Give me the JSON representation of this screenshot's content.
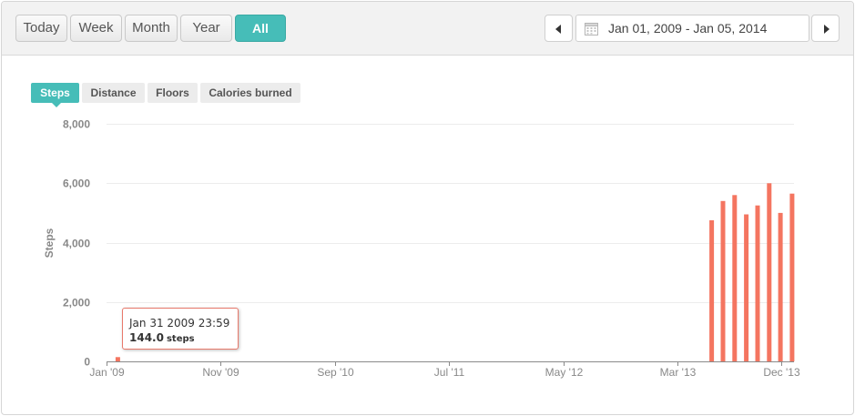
{
  "range_buttons": [
    {
      "label": "Today",
      "active": false
    },
    {
      "label": "Week",
      "active": false
    },
    {
      "label": "Month",
      "active": false
    },
    {
      "label": "Year",
      "active": false
    },
    {
      "label": "All",
      "active": true
    }
  ],
  "date_range": {
    "text": "Jan 01, 2009 - Jan 05, 2014",
    "prev_icon": "caret-left-icon",
    "next_icon": "caret-right-icon",
    "calendar_icon": "calendar-icon"
  },
  "metric_tabs": [
    {
      "label": "Steps",
      "active": true
    },
    {
      "label": "Distance",
      "active": false
    },
    {
      "label": "Floors",
      "active": false
    },
    {
      "label": "Calories burned",
      "active": false
    }
  ],
  "tooltip": {
    "time": "Jan 31 2009 23:59",
    "value": "144.0",
    "unit": "steps"
  },
  "colors": {
    "accent": "#46bdb8",
    "bar": "#f47560",
    "tooltip_border": "#e8796b"
  },
  "chart_data": {
    "type": "bar",
    "title": "",
    "xlabel": "",
    "ylabel": "Steps",
    "ylim": [
      0,
      8000
    ],
    "yticks": [
      0,
      2000,
      4000,
      6000,
      8000
    ],
    "ytick_labels": [
      "0",
      "2,000",
      "4,000",
      "6,000",
      "8,000"
    ],
    "xlim": [
      "2009-01-01",
      "2014-01-05"
    ],
    "xticks": [
      "2009-01-01",
      "2009-11-01",
      "2010-09-01",
      "2011-07-01",
      "2012-05-01",
      "2013-03-01",
      "2013-12-01"
    ],
    "xtick_labels": [
      "Jan '09",
      "Nov '09",
      "Sep '10",
      "Jul '11",
      "May '12",
      "Mar '13",
      "Dec '13"
    ],
    "grid": true,
    "series": [
      {
        "x": [
          "2009-01-31",
          "2013-05-31",
          "2013-06-30",
          "2013-07-31",
          "2013-08-31",
          "2013-09-30",
          "2013-10-31",
          "2013-11-30",
          "2013-12-31"
        ],
        "values": [
          144,
          4750,
          5400,
          5600,
          4950,
          5250,
          6000,
          5000,
          5650
        ]
      }
    ]
  }
}
